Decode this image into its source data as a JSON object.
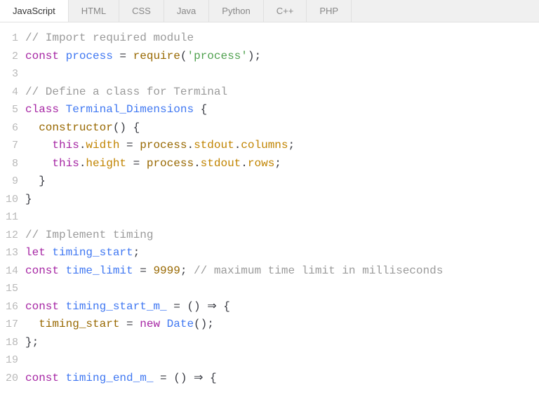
{
  "tabs": [
    {
      "label": "JavaScript",
      "active": true
    },
    {
      "label": "HTML",
      "active": false
    },
    {
      "label": "CSS",
      "active": false
    },
    {
      "label": "Java",
      "active": false
    },
    {
      "label": "Python",
      "active": false
    },
    {
      "label": "C++",
      "active": false
    },
    {
      "label": "PHP",
      "active": false
    }
  ],
  "code": {
    "lines": [
      {
        "n": 1,
        "tokens": [
          {
            "t": "// Import required module",
            "c": "c-comment"
          }
        ]
      },
      {
        "n": 2,
        "tokens": [
          {
            "t": "const ",
            "c": "c-keyword"
          },
          {
            "t": "process",
            "c": "c-def"
          },
          {
            "t": " = ",
            "c": "c-op"
          },
          {
            "t": "require",
            "c": "c-ident"
          },
          {
            "t": "(",
            "c": "c-paren"
          },
          {
            "t": "'process'",
            "c": "c-string"
          },
          {
            "t": ")",
            "c": "c-paren"
          },
          {
            "t": ";",
            "c": "c-plain"
          }
        ]
      },
      {
        "n": 3,
        "tokens": []
      },
      {
        "n": 4,
        "tokens": [
          {
            "t": "// Define a class for Terminal",
            "c": "c-comment"
          }
        ]
      },
      {
        "n": 5,
        "tokens": [
          {
            "t": "class ",
            "c": "c-keyword"
          },
          {
            "t": "Terminal_Dimensions",
            "c": "c-def"
          },
          {
            "t": " {",
            "c": "c-brace"
          }
        ]
      },
      {
        "n": 6,
        "tokens": [
          {
            "t": "  ",
            "c": "c-plain"
          },
          {
            "t": "constructor",
            "c": "c-ident"
          },
          {
            "t": "() {",
            "c": "c-brace"
          }
        ]
      },
      {
        "n": 7,
        "tokens": [
          {
            "t": "    ",
            "c": "c-plain"
          },
          {
            "t": "this",
            "c": "c-this"
          },
          {
            "t": ".",
            "c": "c-plain"
          },
          {
            "t": "width",
            "c": "c-prop"
          },
          {
            "t": " = ",
            "c": "c-op"
          },
          {
            "t": "process",
            "c": "c-ident"
          },
          {
            "t": ".",
            "c": "c-plain"
          },
          {
            "t": "stdout",
            "c": "c-prop"
          },
          {
            "t": ".",
            "c": "c-plain"
          },
          {
            "t": "columns",
            "c": "c-prop"
          },
          {
            "t": ";",
            "c": "c-plain"
          }
        ]
      },
      {
        "n": 8,
        "tokens": [
          {
            "t": "    ",
            "c": "c-plain"
          },
          {
            "t": "this",
            "c": "c-this"
          },
          {
            "t": ".",
            "c": "c-plain"
          },
          {
            "t": "height",
            "c": "c-prop"
          },
          {
            "t": " = ",
            "c": "c-op"
          },
          {
            "t": "process",
            "c": "c-ident"
          },
          {
            "t": ".",
            "c": "c-plain"
          },
          {
            "t": "stdout",
            "c": "c-prop"
          },
          {
            "t": ".",
            "c": "c-plain"
          },
          {
            "t": "rows",
            "c": "c-prop"
          },
          {
            "t": ";",
            "c": "c-plain"
          }
        ]
      },
      {
        "n": 9,
        "tokens": [
          {
            "t": "  }",
            "c": "c-brace"
          }
        ]
      },
      {
        "n": 10,
        "tokens": [
          {
            "t": "}",
            "c": "c-brace"
          }
        ]
      },
      {
        "n": 11,
        "tokens": []
      },
      {
        "n": 12,
        "tokens": [
          {
            "t": "// Implement timing",
            "c": "c-comment"
          }
        ]
      },
      {
        "n": 13,
        "tokens": [
          {
            "t": "let ",
            "c": "c-keyword"
          },
          {
            "t": "timing_start",
            "c": "c-def"
          },
          {
            "t": ";",
            "c": "c-plain"
          }
        ]
      },
      {
        "n": 14,
        "tokens": [
          {
            "t": "const ",
            "c": "c-keyword"
          },
          {
            "t": "time_limit",
            "c": "c-def"
          },
          {
            "t": " = ",
            "c": "c-op"
          },
          {
            "t": "9999",
            "c": "c-num"
          },
          {
            "t": "; ",
            "c": "c-plain"
          },
          {
            "t": "// maximum time limit in milliseconds",
            "c": "c-comment"
          }
        ]
      },
      {
        "n": 15,
        "tokens": []
      },
      {
        "n": 16,
        "tokens": [
          {
            "t": "const ",
            "c": "c-keyword"
          },
          {
            "t": "timing_start_m_",
            "c": "c-def"
          },
          {
            "t": " = () ",
            "c": "c-plain"
          },
          {
            "t": "⇒",
            "c": "c-op"
          },
          {
            "t": " {",
            "c": "c-brace"
          }
        ]
      },
      {
        "n": 17,
        "tokens": [
          {
            "t": "  ",
            "c": "c-plain"
          },
          {
            "t": "timing_start",
            "c": "c-ident"
          },
          {
            "t": " = ",
            "c": "c-op"
          },
          {
            "t": "new ",
            "c": "c-keyword"
          },
          {
            "t": "Date",
            "c": "c-def"
          },
          {
            "t": "();",
            "c": "c-plain"
          }
        ]
      },
      {
        "n": 18,
        "tokens": [
          {
            "t": "};",
            "c": "c-brace"
          }
        ]
      },
      {
        "n": 19,
        "tokens": []
      },
      {
        "n": 20,
        "tokens": [
          {
            "t": "const ",
            "c": "c-keyword"
          },
          {
            "t": "timing_end_m_",
            "c": "c-def"
          },
          {
            "t": " = () ",
            "c": "c-plain"
          },
          {
            "t": "⇒",
            "c": "c-op"
          },
          {
            "t": " {",
            "c": "c-brace"
          }
        ]
      }
    ]
  }
}
